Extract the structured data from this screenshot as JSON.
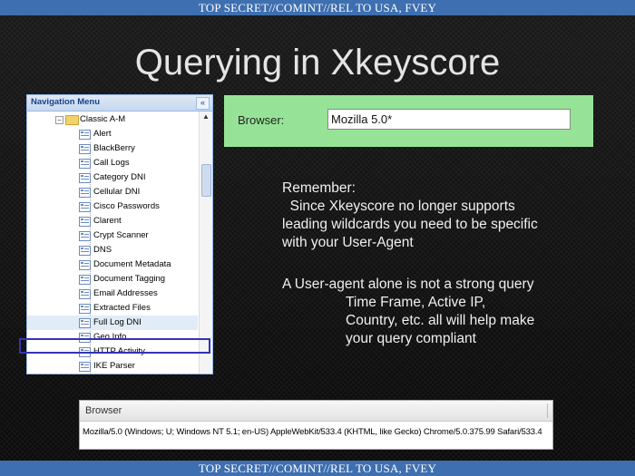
{
  "classification": {
    "top": "TOP SECRET//COMINT//REL TO USA, FVEY",
    "bottom": "TOP SECRET//COMINT//REL TO USA, FVEY"
  },
  "slide_title": "Querying in Xkeyscore",
  "navigation_menu": {
    "title": "Navigation Menu",
    "collapse_glyph": "«",
    "folder": {
      "label": "Classic A-M",
      "expand_glyph": "−"
    },
    "items": [
      "Alert",
      "BlackBerry",
      "Call Logs",
      "Category DNI",
      "Cellular DNI",
      "Cisco Passwords",
      "Clarent",
      "Crypt Scanner",
      "DNS",
      "Document Metadata",
      "Document Tagging",
      "Email Addresses",
      "Extracted Files",
      "Full Log DNI",
      "Geo Info",
      "HTTP Activity",
      "IKE Parser"
    ],
    "highlighted_item": "Full Log DNI",
    "selected_item": "HTTP Activity",
    "scroll_up_glyph": "▲"
  },
  "browser_query": {
    "label": "Browser:",
    "value": "Mozilla 5.0*"
  },
  "note": {
    "heading": "Remember:",
    "lines": [
      "  Since Xkeyscore no longer supports",
      "leading wildcards you need to be specific",
      "with your User-Agent"
    ],
    "para2_first": "A User-agent alone is not a strong query",
    "para2_indented": [
      "Time Frame, Active IP,",
      "Country, etc. all will help make",
      "your query compliant"
    ]
  },
  "browser_field": {
    "label": "Browser",
    "value": "Mozilla/5.0 (Windows; U; Windows NT 5.1; en-US) AppleWebKit/533.4 (KHTML, like Gecko) Chrome/5.0.375.99 Safari/533.4"
  },
  "colors": {
    "banner": "#3e6fb0",
    "query_strip": "#96e397",
    "selection_border": "#3434b4",
    "text_light": "#f0f0f0"
  }
}
